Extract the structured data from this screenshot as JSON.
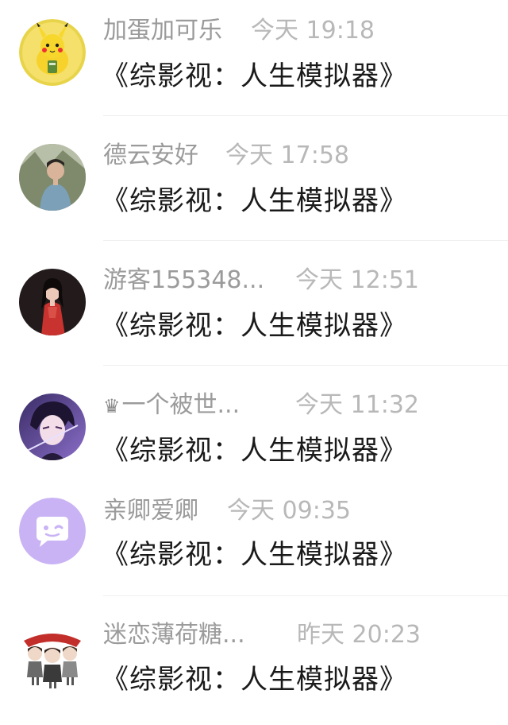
{
  "messages": [
    {
      "name": "加蛋加可乐",
      "time": "今天 19:18",
      "text": "《综影视：人生模拟器》",
      "avatar": "pikachu-avatar"
    },
    {
      "name": "德云安好",
      "time": "今天 17:58",
      "text": "《综影视：人生模拟器》",
      "avatar": "man-outdoors-avatar"
    },
    {
      "name": "游客155348...",
      "time": "今天 12:51",
      "text": "《综影视：人生模拟器》",
      "avatar": "woman-red-dress-avatar"
    },
    {
      "name": "一个被世...",
      "time": "今天 11:32",
      "text": "《综影视：人生模拟器》",
      "avatar": "anime-boy-avatar",
      "badge": "♛"
    },
    {
      "name": "亲卿爱卿",
      "time": "今天 09:35",
      "text": "《综影视：人生模拟器》",
      "avatar": "default-chat-avatar"
    },
    {
      "name": "迷恋薄荷糖...",
      "time": "昨天 20:23",
      "text": "《综影视：人生模拟器》",
      "avatar": "cartoon-girls-avatar"
    }
  ],
  "colors": {
    "name_gray": "#9b9b9b",
    "time_gray": "#b8b8b8",
    "message_text": "#1a1a1a",
    "default_avatar_purple": "#c9b3f5"
  }
}
